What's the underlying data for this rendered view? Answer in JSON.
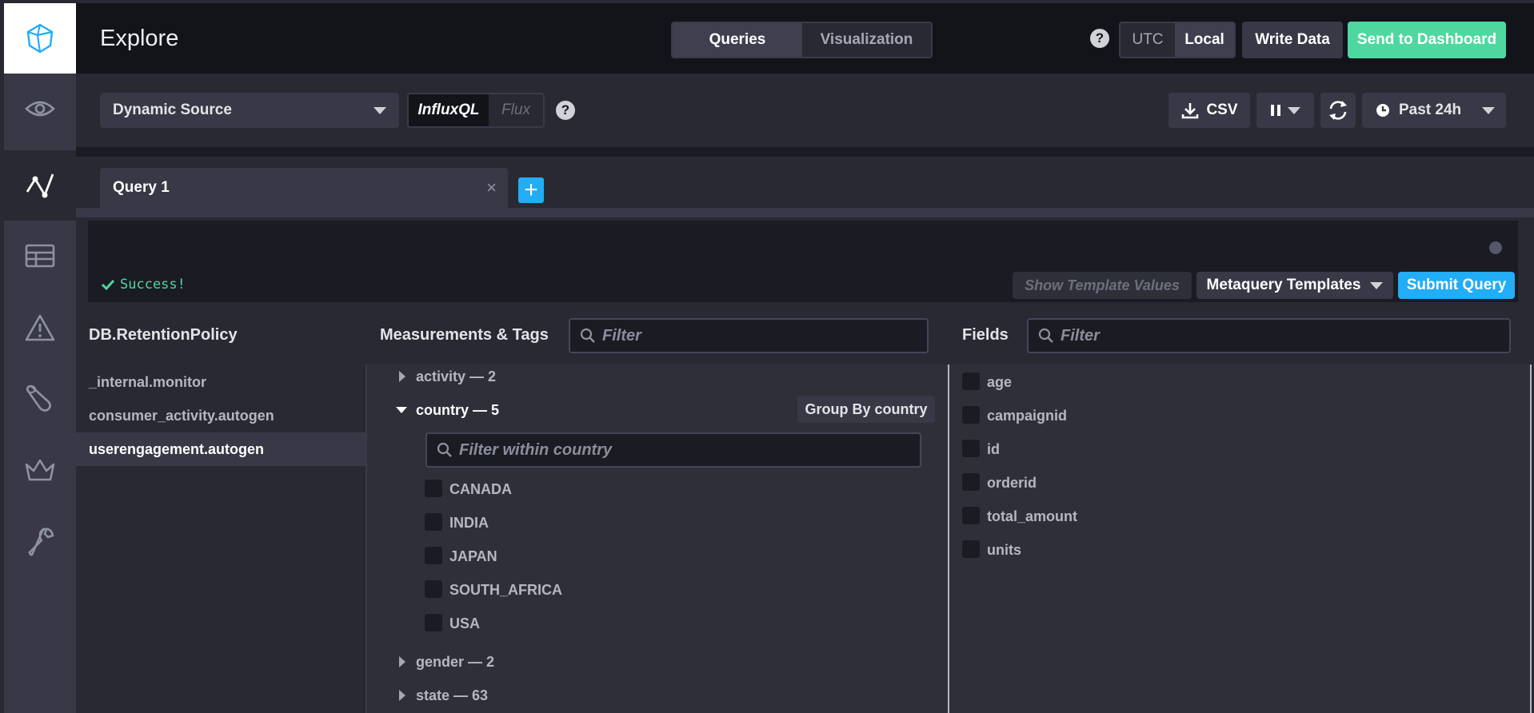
{
  "app": {
    "title": "Explore"
  },
  "header": {
    "tabs": [
      "Queries",
      "Visualization"
    ],
    "active_tab": "Queries",
    "help": "?",
    "timezone": {
      "options": [
        "UTC",
        "Local"
      ],
      "selected": "Local"
    },
    "write_data": "Write Data",
    "send_to_dashboard": "Send to Dashboard"
  },
  "toolbar": {
    "source": "Dynamic Source",
    "languages": [
      "InfluxQL",
      "Flux"
    ],
    "active_language": "InfluxQL",
    "help": "?",
    "csv": "CSV",
    "time_range": "Past 24h"
  },
  "query_tabs": [
    {
      "label": "Query 1"
    }
  ],
  "editor": {
    "status": "Success!",
    "show_template_values": "Show Template Values",
    "metaquery_templates": "Metaquery Templates",
    "submit": "Submit Query"
  },
  "databases": {
    "title": "DB.RetentionPolicy",
    "items": [
      "_internal.monitor",
      "consumer_activity.autogen",
      "userengagement.autogen"
    ],
    "selected": "userengagement.autogen"
  },
  "measurements": {
    "title": "Measurements & Tags",
    "filter_placeholder": "Filter",
    "items": [
      {
        "label": "activity — 2",
        "expanded": false
      },
      {
        "label": "country — 5",
        "expanded": true,
        "group_by": "Group By country",
        "filter_placeholder": "Filter within country",
        "values": [
          "CANADA",
          "INDIA",
          "JAPAN",
          "SOUTH_AFRICA",
          "USA"
        ]
      },
      {
        "label": "gender — 2",
        "expanded": false
      },
      {
        "label": "state — 63",
        "expanded": false
      }
    ]
  },
  "fields": {
    "title": "Fields",
    "filter_placeholder": "Filter",
    "items": [
      "age",
      "campaignid",
      "id",
      "orderid",
      "total_amount",
      "units"
    ]
  },
  "colors": {
    "accent_blue": "#22adf6",
    "accent_green": "#4ed8a0",
    "sidebar": "#383846",
    "header": "#13131a"
  }
}
